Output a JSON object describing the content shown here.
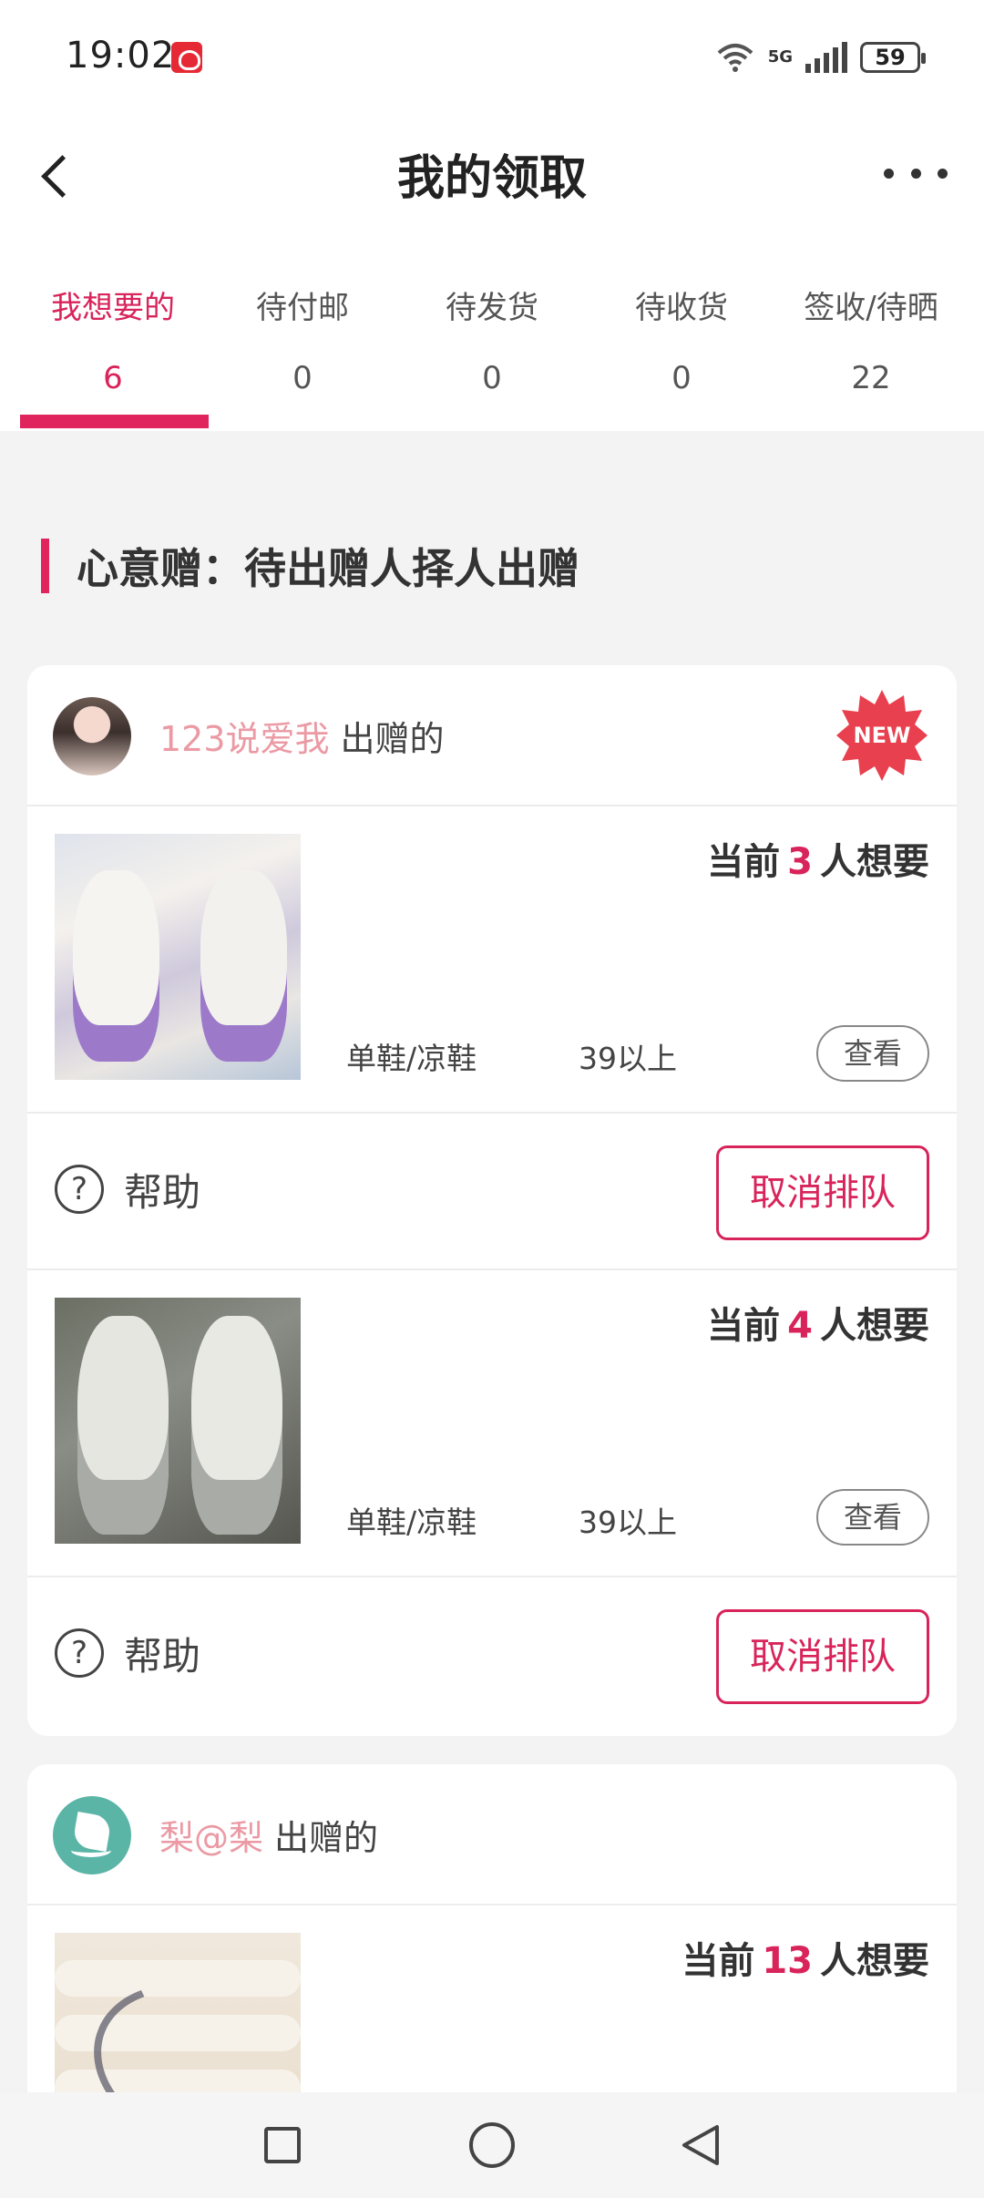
{
  "status_bar": {
    "time": "19:02",
    "network": "5G",
    "battery": "59"
  },
  "header": {
    "title": "我的领取"
  },
  "tabs": [
    {
      "label": "我想要的",
      "count": "6",
      "active": true
    },
    {
      "label": "待付邮",
      "count": "0"
    },
    {
      "label": "待发货",
      "count": "0"
    },
    {
      "label": "待收货",
      "count": "0"
    },
    {
      "label": "签收/待晒",
      "count": "22"
    }
  ],
  "section": {
    "title": "心意赠：待出赠人择人出赠"
  },
  "cards": [
    {
      "giver": "123说爱我",
      "giver_suffix": "出赠的",
      "badge": "NEW",
      "items": [
        {
          "wanted_prefix": "当前",
          "wanted_count": "3",
          "wanted_suffix": "人想要",
          "category": "单鞋/凉鞋",
          "size": "39以上",
          "view_label": "查看",
          "help_label": "帮助",
          "cancel_label": "取消排队"
        },
        {
          "wanted_prefix": "当前",
          "wanted_count": "4",
          "wanted_suffix": "人想要",
          "category": "单鞋/凉鞋",
          "size": "39以上",
          "view_label": "查看",
          "help_label": "帮助",
          "cancel_label": "取消排队"
        }
      ]
    },
    {
      "giver": "梨@梨",
      "giver_suffix": "出赠的",
      "items": [
        {
          "wanted_prefix": "当前",
          "wanted_count": "13",
          "wanted_suffix": "人想要"
        }
      ]
    }
  ],
  "colors": {
    "accent": "#e0245e",
    "giver_name": "#eb9aa4",
    "badge": "#e8404f"
  },
  "icons": {
    "back": "chevron-left-icon",
    "more": "more-dots-icon",
    "help": "question-circle-icon"
  }
}
